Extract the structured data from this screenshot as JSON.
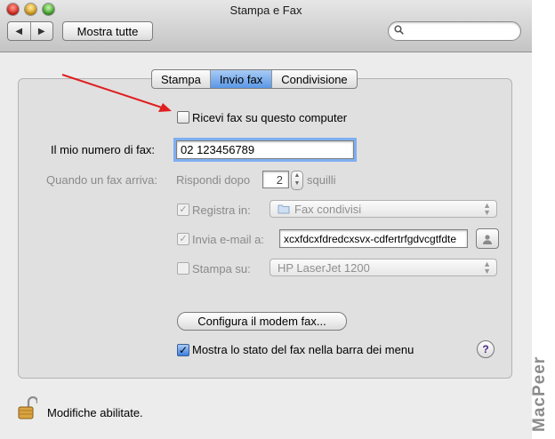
{
  "window": {
    "title": "Stampa e Fax"
  },
  "toolbar": {
    "back_glyph": "◀",
    "forward_glyph": "▶",
    "show_all_label": "Mostra tutte",
    "search": {
      "value": "",
      "placeholder": ""
    }
  },
  "tabs": [
    {
      "label": "Stampa"
    },
    {
      "label": "Invio fax",
      "selected": true
    },
    {
      "label": "Condivisione"
    }
  ],
  "receive_fax": {
    "label": "Ricevi fax su questo computer",
    "checked": false
  },
  "fax_number": {
    "label": "Il mio numero di fax:",
    "value": "02 123456789"
  },
  "when_fax_arrives": {
    "label": "Quando un fax arriva:",
    "answer_after_label": "Rispondi dopo",
    "rings_value": "2",
    "rings_label": "squilli"
  },
  "save_in": {
    "label": "Registra in:",
    "checked": true,
    "selected": "Fax condivisi"
  },
  "email_to": {
    "label": "Invia e-mail a:",
    "checked": true,
    "value": "xcxfdcxfdredcxsvx-cdfertrfgdvcgtfdte"
  },
  "print_on": {
    "label": "Stampa su:",
    "checked": false,
    "selected": "HP LaserJet 1200"
  },
  "configure_modem_label": "Configura il modem fax...",
  "show_status": {
    "label": "Mostra lo stato del fax nella barra dei menu",
    "checked": true
  },
  "help_glyph": "?",
  "lock_status": "Modifiche abilitate.",
  "watermark": "MacPeer",
  "colors": {
    "accent": "#5a97e6",
    "arrow": "#e02020"
  }
}
